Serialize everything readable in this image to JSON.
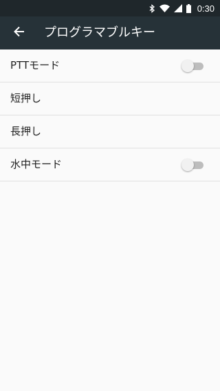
{
  "status_bar": {
    "time": "0:30",
    "icons": [
      "bluetooth-icon",
      "wifi-icon",
      "signal-icon",
      "battery-icon"
    ]
  },
  "app_bar": {
    "back_icon": "arrow-back-icon",
    "title": "プログラマブルキー"
  },
  "settings": [
    {
      "label": "PTTモード",
      "has_switch": true,
      "switch_on": false
    },
    {
      "label": "短押し",
      "has_switch": false
    },
    {
      "label": "長押し",
      "has_switch": false
    },
    {
      "label": "水中モード",
      "has_switch": true,
      "switch_on": false
    }
  ],
  "colors": {
    "status_bar": "#1f272b",
    "app_bar": "#263238",
    "background": "#fafafa",
    "divider": "#e0e0e0",
    "switch_off_track": "#bdbdbd",
    "switch_off_thumb": "#f1f1f1"
  }
}
